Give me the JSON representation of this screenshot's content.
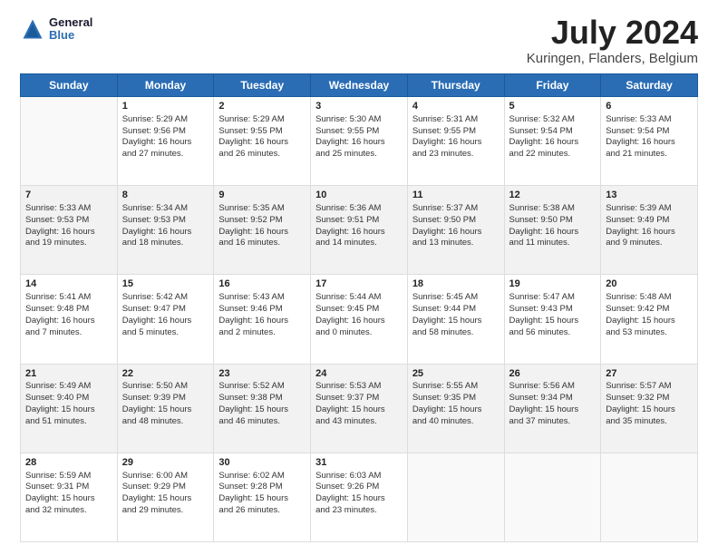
{
  "header": {
    "logo_line1": "General",
    "logo_line2": "Blue",
    "title": "July 2024",
    "subtitle": "Kuringen, Flanders, Belgium"
  },
  "weekdays": [
    "Sunday",
    "Monday",
    "Tuesday",
    "Wednesday",
    "Thursday",
    "Friday",
    "Saturday"
  ],
  "rows": [
    [
      {
        "num": "",
        "lines": []
      },
      {
        "num": "1",
        "lines": [
          "Sunrise: 5:29 AM",
          "Sunset: 9:56 PM",
          "Daylight: 16 hours",
          "and 27 minutes."
        ]
      },
      {
        "num": "2",
        "lines": [
          "Sunrise: 5:29 AM",
          "Sunset: 9:55 PM",
          "Daylight: 16 hours",
          "and 26 minutes."
        ]
      },
      {
        "num": "3",
        "lines": [
          "Sunrise: 5:30 AM",
          "Sunset: 9:55 PM",
          "Daylight: 16 hours",
          "and 25 minutes."
        ]
      },
      {
        "num": "4",
        "lines": [
          "Sunrise: 5:31 AM",
          "Sunset: 9:55 PM",
          "Daylight: 16 hours",
          "and 23 minutes."
        ]
      },
      {
        "num": "5",
        "lines": [
          "Sunrise: 5:32 AM",
          "Sunset: 9:54 PM",
          "Daylight: 16 hours",
          "and 22 minutes."
        ]
      },
      {
        "num": "6",
        "lines": [
          "Sunrise: 5:33 AM",
          "Sunset: 9:54 PM",
          "Daylight: 16 hours",
          "and 21 minutes."
        ]
      }
    ],
    [
      {
        "num": "7",
        "lines": [
          "Sunrise: 5:33 AM",
          "Sunset: 9:53 PM",
          "Daylight: 16 hours",
          "and 19 minutes."
        ]
      },
      {
        "num": "8",
        "lines": [
          "Sunrise: 5:34 AM",
          "Sunset: 9:53 PM",
          "Daylight: 16 hours",
          "and 18 minutes."
        ]
      },
      {
        "num": "9",
        "lines": [
          "Sunrise: 5:35 AM",
          "Sunset: 9:52 PM",
          "Daylight: 16 hours",
          "and 16 minutes."
        ]
      },
      {
        "num": "10",
        "lines": [
          "Sunrise: 5:36 AM",
          "Sunset: 9:51 PM",
          "Daylight: 16 hours",
          "and 14 minutes."
        ]
      },
      {
        "num": "11",
        "lines": [
          "Sunrise: 5:37 AM",
          "Sunset: 9:50 PM",
          "Daylight: 16 hours",
          "and 13 minutes."
        ]
      },
      {
        "num": "12",
        "lines": [
          "Sunrise: 5:38 AM",
          "Sunset: 9:50 PM",
          "Daylight: 16 hours",
          "and 11 minutes."
        ]
      },
      {
        "num": "13",
        "lines": [
          "Sunrise: 5:39 AM",
          "Sunset: 9:49 PM",
          "Daylight: 16 hours",
          "and 9 minutes."
        ]
      }
    ],
    [
      {
        "num": "14",
        "lines": [
          "Sunrise: 5:41 AM",
          "Sunset: 9:48 PM",
          "Daylight: 16 hours",
          "and 7 minutes."
        ]
      },
      {
        "num": "15",
        "lines": [
          "Sunrise: 5:42 AM",
          "Sunset: 9:47 PM",
          "Daylight: 16 hours",
          "and 5 minutes."
        ]
      },
      {
        "num": "16",
        "lines": [
          "Sunrise: 5:43 AM",
          "Sunset: 9:46 PM",
          "Daylight: 16 hours",
          "and 2 minutes."
        ]
      },
      {
        "num": "17",
        "lines": [
          "Sunrise: 5:44 AM",
          "Sunset: 9:45 PM",
          "Daylight: 16 hours",
          "and 0 minutes."
        ]
      },
      {
        "num": "18",
        "lines": [
          "Sunrise: 5:45 AM",
          "Sunset: 9:44 PM",
          "Daylight: 15 hours",
          "and 58 minutes."
        ]
      },
      {
        "num": "19",
        "lines": [
          "Sunrise: 5:47 AM",
          "Sunset: 9:43 PM",
          "Daylight: 15 hours",
          "and 56 minutes."
        ]
      },
      {
        "num": "20",
        "lines": [
          "Sunrise: 5:48 AM",
          "Sunset: 9:42 PM",
          "Daylight: 15 hours",
          "and 53 minutes."
        ]
      }
    ],
    [
      {
        "num": "21",
        "lines": [
          "Sunrise: 5:49 AM",
          "Sunset: 9:40 PM",
          "Daylight: 15 hours",
          "and 51 minutes."
        ]
      },
      {
        "num": "22",
        "lines": [
          "Sunrise: 5:50 AM",
          "Sunset: 9:39 PM",
          "Daylight: 15 hours",
          "and 48 minutes."
        ]
      },
      {
        "num": "23",
        "lines": [
          "Sunrise: 5:52 AM",
          "Sunset: 9:38 PM",
          "Daylight: 15 hours",
          "and 46 minutes."
        ]
      },
      {
        "num": "24",
        "lines": [
          "Sunrise: 5:53 AM",
          "Sunset: 9:37 PM",
          "Daylight: 15 hours",
          "and 43 minutes."
        ]
      },
      {
        "num": "25",
        "lines": [
          "Sunrise: 5:55 AM",
          "Sunset: 9:35 PM",
          "Daylight: 15 hours",
          "and 40 minutes."
        ]
      },
      {
        "num": "26",
        "lines": [
          "Sunrise: 5:56 AM",
          "Sunset: 9:34 PM",
          "Daylight: 15 hours",
          "and 37 minutes."
        ]
      },
      {
        "num": "27",
        "lines": [
          "Sunrise: 5:57 AM",
          "Sunset: 9:32 PM",
          "Daylight: 15 hours",
          "and 35 minutes."
        ]
      }
    ],
    [
      {
        "num": "28",
        "lines": [
          "Sunrise: 5:59 AM",
          "Sunset: 9:31 PM",
          "Daylight: 15 hours",
          "and 32 minutes."
        ]
      },
      {
        "num": "29",
        "lines": [
          "Sunrise: 6:00 AM",
          "Sunset: 9:29 PM",
          "Daylight: 15 hours",
          "and 29 minutes."
        ]
      },
      {
        "num": "30",
        "lines": [
          "Sunrise: 6:02 AM",
          "Sunset: 9:28 PM",
          "Daylight: 15 hours",
          "and 26 minutes."
        ]
      },
      {
        "num": "31",
        "lines": [
          "Sunrise: 6:03 AM",
          "Sunset: 9:26 PM",
          "Daylight: 15 hours",
          "and 23 minutes."
        ]
      },
      {
        "num": "",
        "lines": []
      },
      {
        "num": "",
        "lines": []
      },
      {
        "num": "",
        "lines": []
      }
    ]
  ]
}
